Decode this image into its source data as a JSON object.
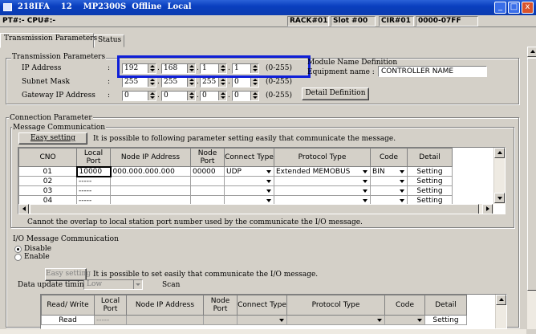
{
  "window": {
    "title": "218IFA    12    MP2300S  Offline  Local",
    "minimize_icon": "minimize-icon",
    "maximize_icon": "maximize-icon",
    "close_icon": "close-icon",
    "minimize_glyph": "_",
    "maximize_glyph": "□",
    "close_glyph": "x"
  },
  "infobar": {
    "pt_cpu": "PT#:- CPU#:-",
    "rack": "RACK#01",
    "slot": "Slot #00",
    "cir": "CIR#01",
    "range": "0000-07FF"
  },
  "tabs": [
    {
      "label": "Transmission Parameters",
      "active": true
    },
    {
      "label": "Status",
      "active": false
    }
  ],
  "transmission": {
    "group_title": "Transmission Parameters",
    "ip_label": "IP Address",
    "subnet_label": "Subnet Mask",
    "gateway_label": "Gateway IP Address",
    "colon": ":",
    "dot": ".",
    "range_hint": "(0-255)",
    "ip": [
      "192",
      "168",
      "1",
      "1"
    ],
    "subnet": [
      "255",
      "255",
      "255",
      "0"
    ],
    "gateway": [
      "0",
      "0",
      "0",
      "0"
    ],
    "module_name_title": "Module Name Definition",
    "equipment_label": "Equipment name :",
    "equipment_name": "CONTROLLER NAME",
    "detail_button": "Detail Definition"
  },
  "connection": {
    "group_title": "Connection Parameter",
    "message_title": "Message Communication",
    "easy_setting": "Easy setting",
    "easy_hint": "It is possible to following parameter setting easily that communicate the  message.",
    "headers": {
      "cno": "CNO",
      "local_port": "Local Port",
      "node_ip": "Node IP Address",
      "node_port": "Node Port",
      "connect_type": "Connect Type",
      "protocol_type": "Protocol Type",
      "code": "Code",
      "detail": "Detail"
    },
    "rows": [
      {
        "cno": "01",
        "local_port": "10000",
        "node_ip": "000.000.000.000",
        "node_port": "00000",
        "connect_type": "UDP",
        "protocol": "Extended MEMOBUS",
        "code": "BIN",
        "detail": "Setting"
      },
      {
        "cno": "02",
        "local_port": "-----",
        "node_ip": "",
        "node_port": "",
        "connect_type": "",
        "protocol": "",
        "code": "",
        "detail": "Setting"
      },
      {
        "cno": "03",
        "local_port": "-----",
        "node_ip": "",
        "node_port": "",
        "connect_type": "",
        "protocol": "",
        "code": "",
        "detail": "Setting"
      },
      {
        "cno": "04",
        "local_port": "-----",
        "node_ip": "",
        "node_port": "",
        "connect_type": "",
        "protocol": "",
        "code": "",
        "detail": "Setting"
      }
    ],
    "overlap_note": "Cannot the overlap to local station port number used by the communicate the  I/O message."
  },
  "io": {
    "title": "I/O Message Communication",
    "disable_label": "Disable",
    "enable_label": "Enable",
    "selected": "Disable",
    "easy_setting": "Easy setting",
    "easy_hint": "It is possible to set easily that communicate the I/O message.",
    "update_label": "Data update timing",
    "update_value": "Low",
    "scan_label": "Scan",
    "headers": {
      "read_write": "Read/ Write",
      "local_port": "Local Port",
      "node_ip": "Node IP Address",
      "node_port": "Node Port",
      "connect_type": "Connect Type",
      "protocol_type": "Protocol Type",
      "code": "Code",
      "detail": "Detail"
    },
    "rows": [
      {
        "rw": "Read",
        "local_port": "-----",
        "detail": "Setting"
      }
    ]
  },
  "colors": {
    "title_bar": "#0a3fbf",
    "highlight_box": "#0f1fd8",
    "face": "#d4d0c8"
  }
}
